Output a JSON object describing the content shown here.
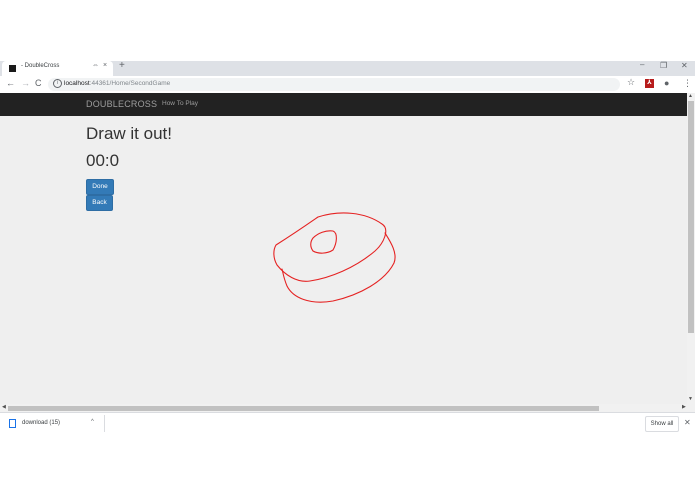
{
  "browser": {
    "tab_title": "- DoubleCross",
    "tab_extra": "⇔",
    "tab_close": "×",
    "new_tab": "+",
    "window_controls": {
      "minimize": "–",
      "maximize": "❐",
      "close": "✕"
    },
    "nav": {
      "back": "←",
      "forward": "→",
      "reload": "C"
    },
    "url_host": "localhost",
    "url_path": ":44361/Home/SecondGame",
    "icons": {
      "site_info": "info-icon",
      "bookmark": "star-icon",
      "extension": "pdf-extension-icon",
      "profile": "account-icon",
      "menu": "kebab-menu-icon"
    },
    "extension_label": "⅄",
    "star": "☆",
    "profile": "●",
    "menu": "⋮"
  },
  "page": {
    "brand": "DOUBLECROSS",
    "nav_items": [
      "How To Play"
    ],
    "heading": "Draw it out!",
    "timer": "00:0",
    "buttons": {
      "done": "Done",
      "back": "Back"
    },
    "drawing_color": "#e52222",
    "navbar_color": "#222222",
    "button_color": "#337ab7",
    "background_color": "#efefef"
  },
  "scrollbars": {
    "up": "▲",
    "down": "▼",
    "left": "◀",
    "right": "▶"
  },
  "download_bar": {
    "file_name": "download (15)",
    "chevron": "^",
    "show_all": "Show all",
    "close": "✕"
  }
}
